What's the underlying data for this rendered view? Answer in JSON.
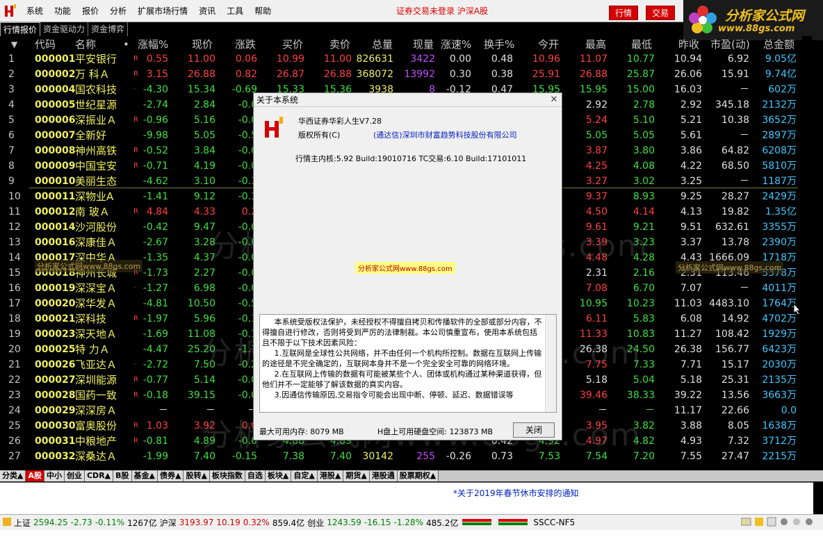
{
  "menu": {
    "items": [
      "系统",
      "功能",
      "报价",
      "分析",
      "扩展市场行情",
      "资讯",
      "工具",
      "帮助"
    ],
    "notice": "证券交易未登录 沪深A股",
    "btn_quote": "行情",
    "btn_trade": "交易"
  },
  "brand": {
    "name": "分析家公式网",
    "url": "www.88gs.com"
  },
  "subtabs": [
    "行情报价",
    "资金驱动力",
    "资金博弈"
  ],
  "columns": [
    "▼",
    "代码",
    "名称",
    "•",
    "涨幅%",
    "现价",
    "涨跌",
    "买价",
    "卖价",
    "总量",
    "现量",
    "涨速%",
    "换手%",
    "今开",
    "最高",
    "最低",
    "昨收",
    "市盈(动)",
    "总金额"
  ],
  "rows": [
    {
      "no": "1",
      "code": "000001",
      "name": "平安银行",
      "r": "R",
      "chg_pct": "0.55",
      "price": "11.00",
      "chg": "0.06",
      "bid": "10.99",
      "ask": "11.00",
      "vol": "826631",
      "cur": "3422",
      "speed": "0.00",
      "turnover": "0.48",
      "open": "10.96",
      "high": "11.07",
      "low": "10.77",
      "prev": "10.94",
      "pe": "6.92",
      "amt": "9.05亿",
      "dir": "up"
    },
    {
      "no": "2",
      "code": "000002",
      "name": "万 科Ａ",
      "r": "R",
      "chg_pct": "3.15",
      "price": "26.88",
      "chg": "0.82",
      "bid": "26.87",
      "ask": "26.88",
      "vol": "368072",
      "cur": "13992",
      "speed": "0.30",
      "turnover": "0.38",
      "open": "25.91",
      "high": "26.88",
      "low": "25.87",
      "prev": "26.06",
      "pe": "15.91",
      "amt": "9.74亿",
      "dir": "up"
    },
    {
      "no": "3",
      "code": "000004",
      "name": "国农科技",
      "r": "·",
      "chg_pct": "-4.30",
      "price": "15.34",
      "chg": "-0.69",
      "bid": "15.33",
      "ask": "15.36",
      "vol": "3938",
      "cur": "8",
      "speed": "-0.12",
      "turnover": "0.47",
      "open": "15.95",
      "high": "15.95",
      "low": "15.00",
      "prev": "16.03",
      "pe": "－",
      "amt": "602万",
      "dir": "dn"
    },
    {
      "no": "4",
      "code": "000005",
      "name": "世纪星源",
      "r": "",
      "chg_pct": "-2.74",
      "price": "2.84",
      "chg": "-0.0",
      "bid": "",
      "ask": "",
      "vol": "",
      "cur": "",
      "speed": "",
      "turnover": "",
      "open": "",
      "high": "2.92",
      "low": "2.78",
      "prev": "2.92",
      "pe": "345.18",
      "amt": "2132万",
      "dir": "dn"
    },
    {
      "no": "5",
      "code": "000006",
      "name": "深振业Ａ",
      "r": "R",
      "chg_pct": "-0.96",
      "price": "5.16",
      "chg": "-0.0",
      "bid": "",
      "ask": "",
      "vol": "",
      "cur": "",
      "speed": "",
      "turnover": "",
      "open": "",
      "high": "5.24",
      "low": "5.10",
      "prev": "5.21",
      "pe": "10.38",
      "amt": "3652万",
      "dir": "dn"
    },
    {
      "no": "6",
      "code": "000007",
      "name": "全新好",
      "r": "",
      "chg_pct": "-9.98",
      "price": "5.05",
      "chg": "-0.5",
      "bid": "",
      "ask": "",
      "vol": "",
      "cur": "",
      "speed": "",
      "turnover": "",
      "open": "",
      "high": "5.05",
      "low": "5.05",
      "prev": "5.61",
      "pe": "－",
      "amt": "2897万",
      "dir": "dn"
    },
    {
      "no": "7",
      "code": "000008",
      "name": "神州高铁",
      "r": "R",
      "chg_pct": "-0.52",
      "price": "3.84",
      "chg": "-0.0",
      "bid": "",
      "ask": "",
      "vol": "",
      "cur": "",
      "speed": "",
      "turnover": "",
      "open": "",
      "high": "3.87",
      "low": "3.80",
      "prev": "3.86",
      "pe": "64.82",
      "amt": "6208万",
      "dir": "dn"
    },
    {
      "no": "8",
      "code": "000009",
      "name": "中国宝安",
      "r": "R",
      "chg_pct": "-0.71",
      "price": "4.19",
      "chg": "-0.0",
      "bid": "",
      "ask": "",
      "vol": "",
      "cur": "",
      "speed": "",
      "turnover": "",
      "open": "",
      "high": "4.25",
      "low": "4.08",
      "prev": "4.22",
      "pe": "68.50",
      "amt": "5810万",
      "dir": "dn"
    },
    {
      "no": "9",
      "code": "000010",
      "name": "美丽生态",
      "r": "",
      "chg_pct": "-4.62",
      "price": "3.10",
      "chg": "-0.1",
      "bid": "",
      "ask": "",
      "vol": "",
      "cur": "",
      "speed": "",
      "turnover": "",
      "open": "",
      "high": "3.27",
      "low": "3.02",
      "prev": "3.25",
      "pe": "－",
      "amt": "1187万",
      "dir": "dn"
    },
    {
      "no": "10",
      "code": "000011",
      "name": "深物业A",
      "r": "",
      "chg_pct": "-1.41",
      "price": "9.12",
      "chg": "-0.1",
      "bid": "",
      "ask": "",
      "vol": "",
      "cur": "",
      "speed": "",
      "turnover": "",
      "open": "",
      "high": "9.37",
      "low": "8.93",
      "prev": "9.25",
      "pe": "28.27",
      "amt": "2429万",
      "dir": "dn"
    },
    {
      "no": "11",
      "code": "000012",
      "name": "南 玻Ａ",
      "r": "R",
      "chg_pct": "4.84",
      "price": "4.33",
      "chg": "0.2",
      "bid": "",
      "ask": "",
      "vol": "",
      "cur": "",
      "speed": "",
      "turnover": "",
      "open": "",
      "high": "4.50",
      "low": "4.14",
      "prev": "4.13",
      "pe": "19.82",
      "amt": "1.35亿",
      "dir": "up"
    },
    {
      "no": "12",
      "code": "000014",
      "name": "沙河股份",
      "r": "",
      "chg_pct": "-0.42",
      "price": "9.47",
      "chg": "-0.0",
      "bid": "",
      "ask": "",
      "vol": "",
      "cur": "",
      "speed": "",
      "turnover": "",
      "open": "",
      "high": "9.61",
      "low": "9.21",
      "prev": "9.51",
      "pe": "632.61",
      "amt": "3355万",
      "dir": "dn"
    },
    {
      "no": "13",
      "code": "000016",
      "name": "深康佳Ａ",
      "r": "",
      "chg_pct": "-2.67",
      "price": "3.28",
      "chg": "-0.0",
      "bid": "",
      "ask": "",
      "vol": "",
      "cur": "",
      "speed": "",
      "turnover": "",
      "open": "",
      "high": "3.39",
      "low": "3.23",
      "prev": "3.37",
      "pe": "13.78",
      "amt": "2390万",
      "dir": "dn"
    },
    {
      "no": "14",
      "code": "000017",
      "name": "深中华Ａ",
      "r": "",
      "chg_pct": "-1.35",
      "price": "4.37",
      "chg": "-0.0",
      "bid": "",
      "ask": "",
      "vol": "",
      "cur": "",
      "speed": "",
      "turnover": "",
      "open": "",
      "high": "4.48",
      "low": "4.28",
      "prev": "4.43",
      "pe": "1666.09",
      "amt": "1718万",
      "dir": "dn"
    },
    {
      "no": "15",
      "code": "000018",
      "name": "神州长城",
      "r": "R",
      "chg_pct": "-1.73",
      "price": "2.27",
      "chg": "-0.0",
      "bid": "",
      "ask": "",
      "vol": "",
      "cur": "",
      "speed": "",
      "turnover": "",
      "open": "",
      "high": "2.31",
      "low": "2.16",
      "prev": "2.31",
      "pe": "113.46",
      "amt": "5378万",
      "dir": "dn"
    },
    {
      "no": "16",
      "code": "000019",
      "name": "深深宝Ａ",
      "r": "·",
      "chg_pct": "-1.27",
      "price": "6.98",
      "chg": "-0.0",
      "bid": "",
      "ask": "",
      "vol": "",
      "cur": "",
      "speed": "",
      "turnover": "",
      "open": "",
      "high": "7.08",
      "low": "6.70",
      "prev": "7.07",
      "pe": "－",
      "amt": "4011万",
      "dir": "dn"
    },
    {
      "no": "17",
      "code": "000020",
      "name": "深华发Ａ",
      "r": "",
      "chg_pct": "-4.81",
      "price": "10.50",
      "chg": "-0.5",
      "bid": "",
      "ask": "",
      "vol": "",
      "cur": "",
      "speed": "",
      "turnover": "",
      "open": "",
      "high": "10.95",
      "low": "10.23",
      "prev": "11.03",
      "pe": "4483.10",
      "amt": "1764万",
      "dir": "dn"
    },
    {
      "no": "18",
      "code": "000021",
      "name": "深科技",
      "r": "R",
      "chg_pct": "-1.97",
      "price": "5.96",
      "chg": "-0.1",
      "bid": "",
      "ask": "",
      "vol": "",
      "cur": "",
      "speed": "",
      "turnover": "",
      "open": "",
      "high": "6.11",
      "low": "5.83",
      "prev": "6.08",
      "pe": "14.92",
      "amt": "4702万",
      "dir": "dn"
    },
    {
      "no": "19",
      "code": "000023",
      "name": "深天地Ａ",
      "r": "",
      "chg_pct": "-1.69",
      "price": "11.08",
      "chg": "-0.1",
      "bid": "",
      "ask": "",
      "vol": "",
      "cur": "",
      "speed": "",
      "turnover": "",
      "open": "",
      "high": "11.33",
      "low": "10.83",
      "prev": "11.27",
      "pe": "108.42",
      "amt": "1929万",
      "dir": "dn"
    },
    {
      "no": "20",
      "code": "000025",
      "name": "特 力Ａ",
      "r": "",
      "chg_pct": "-4.47",
      "price": "25.20",
      "chg": "-1.1",
      "bid": "",
      "ask": "",
      "vol": "",
      "cur": "",
      "speed": "",
      "turnover": "",
      "open": "",
      "high": "26.38",
      "low": "24.50",
      "prev": "26.38",
      "pe": "156.77",
      "amt": "6423万",
      "dir": "dn"
    },
    {
      "no": "21",
      "code": "000026",
      "name": "飞亚达Ａ",
      "r": "·",
      "chg_pct": "-2.72",
      "price": "7.50",
      "chg": "-0.2",
      "bid": "",
      "ask": "",
      "vol": "",
      "cur": "",
      "speed": "",
      "turnover": "",
      "open": "",
      "high": "7.75",
      "low": "7.33",
      "prev": "7.71",
      "pe": "15.17",
      "amt": "2030万",
      "dir": "dn"
    },
    {
      "no": "22",
      "code": "000027",
      "name": "深圳能源",
      "r": "R",
      "chg_pct": "-0.77",
      "price": "5.14",
      "chg": "-0.0",
      "bid": "",
      "ask": "",
      "vol": "",
      "cur": "",
      "speed": "",
      "turnover": "",
      "open": "",
      "high": "5.18",
      "low": "5.04",
      "prev": "5.18",
      "pe": "25.31",
      "amt": "2135万",
      "dir": "dn"
    },
    {
      "no": "23",
      "code": "000028",
      "name": "国药一致",
      "r": "R",
      "chg_pct": "-0.18",
      "price": "39.15",
      "chg": "-0.0",
      "bid": "",
      "ask": "",
      "vol": "",
      "cur": "",
      "speed": "",
      "turnover": "",
      "open": "",
      "high": "39.46",
      "low": "38.33",
      "prev": "39.22",
      "pe": "13.56",
      "amt": "3663万",
      "dir": "dn"
    },
    {
      "no": "24",
      "code": "000029",
      "name": "深深房Ａ",
      "r": "",
      "chg_pct": "－",
      "price": "－",
      "chg": "－",
      "bid": "",
      "ask": "",
      "vol": "",
      "cur": "",
      "speed": "",
      "turnover": "",
      "open": "",
      "high": "－",
      "low": "－",
      "prev": "11.17",
      "pe": "22.66",
      "amt": "0.0",
      "dir": "flat"
    },
    {
      "no": "25",
      "code": "000030",
      "name": "富奥股份",
      "r": "R",
      "chg_pct": "1.03",
      "price": "3.92",
      "chg": "0.0",
      "bid": "",
      "ask": "",
      "vol": "",
      "cur": "",
      "speed": "",
      "turnover": "",
      "open": "",
      "high": "3.95",
      "low": "3.82",
      "prev": "3.88",
      "pe": "8.05",
      "amt": "1638万",
      "dir": "up"
    },
    {
      "no": "26",
      "code": "000031",
      "name": "中粮地产",
      "r": "R",
      "chg_pct": "-0.81",
      "price": "4.89",
      "chg": "-0.0",
      "bid": "4.88",
      "ask": "4.89",
      "vol": "",
      "cur": "",
      "speed": "",
      "turnover": "0.42",
      "open": "4.92",
      "high": "4.97",
      "low": "4.82",
      "prev": "4.93",
      "pe": "7.32",
      "amt": "3712万",
      "dir": "dn"
    },
    {
      "no": "27",
      "code": "000032",
      "name": "深桑达Ａ",
      "r": "",
      "chg_pct": "-1.99",
      "price": "7.40",
      "chg": "-0.15",
      "bid": "7.38",
      "ask": "7.40",
      "vol": "30142",
      "cur": "255",
      "speed": "-0.26",
      "turnover": "0.73",
      "open": "7.53",
      "high": "7.54",
      "low": "7.20",
      "prev": "7.55",
      "pe": "27.47",
      "amt": "2215万",
      "dir": "dn"
    }
  ],
  "watermark": "分析家公式网www.88gs.com",
  "bottom_tabs": [
    "分类▲",
    "A股",
    "中小",
    "创业",
    "CDR▲",
    "B股",
    "基金▲",
    "债券▲",
    "股转▲",
    "板块指数",
    "自选",
    "板块▲",
    "自定▲",
    "港股▲",
    "期货▲",
    "港股通",
    "股票期权▲"
  ],
  "news": "*关于2019年春节休市安排的通知",
  "status": {
    "sh_label": "上证",
    "sh_val": "2594.25",
    "sh_chg": "-2.73",
    "sh_pct": "-0.11%",
    "sh_amt": "1267亿",
    "hs_label": "沪深",
    "hs_val": "3193.97",
    "hs_chg": "10.19",
    "hs_pct": "0.32%",
    "hs_amt": "859.4亿",
    "cy_label": "创业",
    "cy_val": "1243.59",
    "cy_chg": "-16.15",
    "cy_pct": "-1.28%",
    "cy_amt": "485.2亿",
    "server": "SSCC-NF5"
  },
  "dialog": {
    "title": "关于本系统",
    "product": "华西证券华彩人生V7.28",
    "copyright_label": "版权所有(C)",
    "copyright_owner": "(通达信)深圳市财富趋势科技股份有限公司",
    "build": "行情主内核:5.92 Build:19010716 TC交易:6.10 Build:17101011",
    "badge": "分析家公式网www.88gs.com",
    "disclaimer": [
      "本系统受版权法保护，未经授权不得擅自拷贝和传播软件的全部或部分内容，不得擅自进行修改，否则将受到严厉的法律制裁。本公司慎重宣布，使用本系统包括且不限于以下技术因素风险：",
      "1.互联网是全球性公共网络，并不由任何一个机构所控制。数据在互联网上传输的途径是不完全确定的，互联网本身并不是一个完全安全可靠的网络环境。",
      "2.在互联网上传输的数据有可能被某些个人、团体或机构通过某种渠道获得，但他们并不一定能够了解该数据的真实内容。",
      "3.因通信传输原因,交易指令可能会出现中断、停顿、延迟、数据错误等"
    ],
    "mem": "最大可用内存: 8079 MB",
    "disk": "H盘上可用硬盘空间: 123873 MB",
    "close_btn": "关闭"
  }
}
